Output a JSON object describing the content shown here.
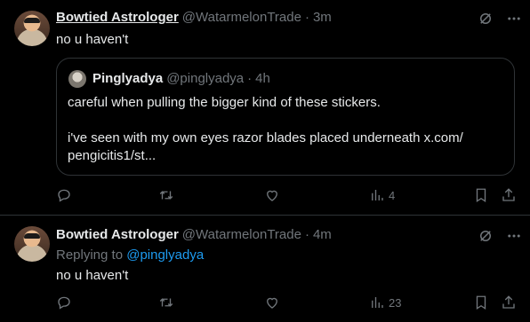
{
  "tweet1": {
    "author_name": "Bowtied Astrologer",
    "author_handle": "@WatarmelonTrade",
    "separator": "·",
    "time": "3m",
    "text": "no u haven't",
    "quote": {
      "author_name": "Pinglyadya",
      "author_handle": "@pinglyadya",
      "separator": "·",
      "time": "4h",
      "line1": "careful when pulling the bigger kind of these stickers.",
      "line2": "i've seen with my own eyes razor blades placed underneath x.com/",
      "line3": "pengicitis1/st..."
    },
    "views": "4"
  },
  "tweet2": {
    "author_name": "Bowtied Astrologer",
    "author_handle": "@WatarmelonTrade",
    "separator": "·",
    "time": "4m",
    "replying_prefix": "Replying to ",
    "replying_handle": "@pinglyadya",
    "text": "no u haven't",
    "views": "23"
  },
  "icons": [
    "grok-icon",
    "more-icon",
    "reply-icon",
    "retweet-icon",
    "like-icon",
    "views-icon",
    "bookmark-icon",
    "share-icon"
  ],
  "colors": {
    "background": "#000000",
    "text": "#e7e9ea",
    "muted": "#71767b",
    "link": "#1d9bf0",
    "border": "#2f3336"
  }
}
